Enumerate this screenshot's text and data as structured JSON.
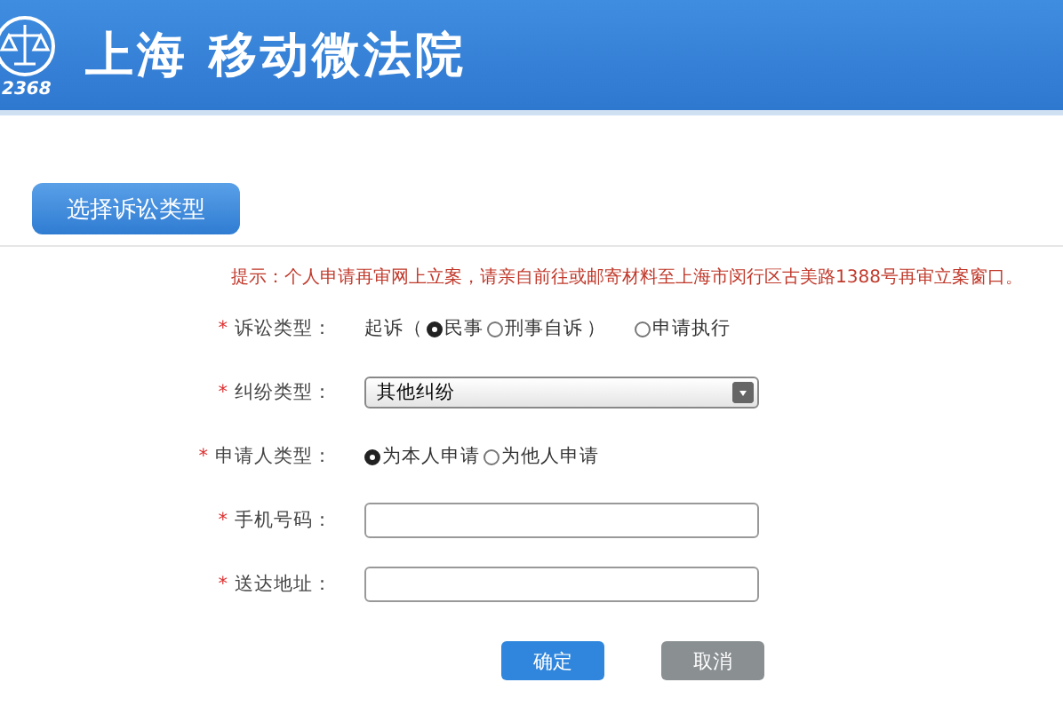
{
  "header": {
    "logo_number": "2368",
    "title": "上海 移动微法院"
  },
  "section_tab": {
    "label": "选择诉讼类型",
    "selected": true
  },
  "hint": "提示：个人申请再审网上立案，请亲自前往或邮寄材料至上海市闵行区古美路1388号再审立案窗口。",
  "fields": [
    {
      "kind": "radios",
      "required_mark": "*",
      "label": "诉讼类型：",
      "items": [
        {
          "kind": "text",
          "text": "起诉（"
        },
        {
          "kind": "radio",
          "text": "民事",
          "selected": true
        },
        {
          "kind": "radio",
          "text": "刑事自诉",
          "selected": false
        },
        {
          "kind": "text",
          "text": "）"
        },
        {
          "kind": "radio",
          "text": "申请执行",
          "selected": false
        }
      ]
    },
    {
      "kind": "select",
      "required_mark": "*",
      "label": "纠纷类型：",
      "value": "其他纠纷"
    },
    {
      "kind": "radios",
      "required_mark": "*",
      "label": "申请人类型：",
      "items": [
        {
          "kind": "radio",
          "text": "为本人申请",
          "selected": true
        },
        {
          "kind": "radio",
          "text": "为他人申请",
          "selected": false
        }
      ]
    },
    {
      "kind": "input",
      "required_mark": "*",
      "label": "手机号码："
    },
    {
      "kind": "input",
      "required_mark": "*",
      "label": "送达地址："
    }
  ],
  "buttons": [
    {
      "kind": "primary",
      "label": "确定"
    },
    {
      "kind": "secondary",
      "label": "取消"
    }
  ]
}
